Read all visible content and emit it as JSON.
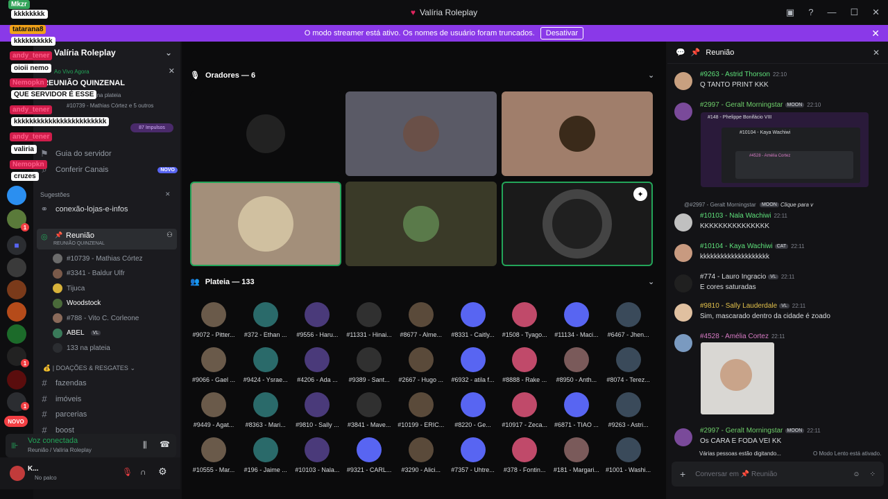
{
  "window": {
    "title": "Valíria Roleplay",
    "icons": [
      "inbox-icon",
      "help-icon",
      "minimize-icon",
      "maximize-icon",
      "close-icon"
    ]
  },
  "banner": {
    "text": "O modo streamer está ativo. Os nomes de usuário foram truncados.",
    "button": "Desativar"
  },
  "server": {
    "name": "Valíria Roleplay"
  },
  "live": {
    "label": "Ao Vivo Agora",
    "event": "REUNIÃO QUINZENAL",
    "audience": "133 na plateia",
    "speakers": "#10739 - Mathias Córtez e 5 outros"
  },
  "boost": {
    "label": "87 Impulsos"
  },
  "channels_top": [
    {
      "label": "Guia do servidor"
    },
    {
      "label": "Conferir Canais",
      "badge": "NOVO"
    }
  ],
  "suggestions": {
    "label": "Sugestões",
    "item": "conexão-lojas-e-infos"
  },
  "voice_channel": {
    "name": "Reunião",
    "sub": "REUNIÃO QUINZENAL"
  },
  "voice_users": [
    {
      "name": "#10739 - Mathias Córtez"
    },
    {
      "name": "#3341 - Baldur Ulfr"
    },
    {
      "name": "Tijuca"
    },
    {
      "name": "Woodstock"
    },
    {
      "name": "#788 - Vito C. Corleone"
    },
    {
      "name": "ABEL",
      "tag": "VL"
    },
    {
      "name": "133 na plateia"
    }
  ],
  "category": {
    "label": "| DOAÇÕES & RESGATES"
  },
  "channels_bottom": [
    {
      "label": "fazendas"
    },
    {
      "label": "imóveis"
    },
    {
      "label": "parcerias"
    },
    {
      "label": "boost"
    }
  ],
  "voicebar": {
    "status": "Voz conectada",
    "location": "Reunião / Valíria Roleplay"
  },
  "userbar": {
    "name": "K...",
    "status": "No palco"
  },
  "guild_badges": {
    "new_label": "NOVO"
  },
  "overlay": [
    {
      "text": "Mkzr",
      "style": "g"
    },
    {
      "text": "kkkkkkkk",
      "style": "w"
    },
    {
      "text": "tatarana8",
      "style": "o"
    },
    {
      "text": "kkkkkkkkkk",
      "style": "w"
    },
    {
      "text": "andy_tener",
      "style": "p"
    },
    {
      "text": "oioii nemo",
      "style": "w"
    },
    {
      "text": "Nemopkn",
      "style": "p"
    },
    {
      "text": "QUE SERVIDOR É ESSE",
      "style": "w"
    },
    {
      "text": "andy_tener",
      "style": "p"
    },
    {
      "text": "kkkkkkkkkkkkkkkkkkkkkkkk",
      "style": "w"
    },
    {
      "text": "andy_tener",
      "style": "p"
    },
    {
      "text": "valiria",
      "style": "w"
    },
    {
      "text": "Nemopkn",
      "style": "p"
    },
    {
      "text": "cruzes",
      "style": "w"
    }
  ],
  "stage": {
    "speakers_label": "Oradores — 6",
    "audience_label": "Plateia — 133",
    "tiles": [
      {
        "bg": "#0b0b0c"
      },
      {
        "bg": "#5a5a66"
      },
      {
        "bg": "#a07e6b"
      },
      {
        "bg": "#a38f7a"
      },
      {
        "bg": "#3a3a28"
      },
      {
        "bg": "#1a1a1a"
      }
    ],
    "audience": [
      "#9072 - Pitter...",
      "#372 - Ethan ...",
      "#9556 - Haru...",
      "#11331 - Hinai...",
      "#8677 - Alme...",
      "#8331 - Caitly...",
      "#1508 - Tyago...",
      "#11134 - Maci...",
      "#6467 - Jhen...",
      "#9066 - Gael ...",
      "#9424 - Ysrae...",
      "#4206 - Ada ...",
      "#9389 - Sant...",
      "#2667 - Hugo ...",
      "#6932 - atila f...",
      "#8888 - Rake ...",
      "#8950 - Anth...",
      "#8074 - Terez...",
      "#9449 - Agat...",
      "#8363 - Mari...",
      "#9810 - Sally ...",
      "#3841 - Mave...",
      "#10199 - ERIC...",
      "#8220 - Ge...",
      "#10917 - Zeca...",
      "#6871 - TIAO ...",
      "#9263 - Astri...",
      "#10555 - Mar...",
      "#196 - Jaime ...",
      "#10103 - Nala...",
      "#9321 - CARL...",
      "#3290 - Alici...",
      "#7357 - Uhtre...",
      "#378 - Fontin...",
      "#181 - Margari...",
      "#1001 - Washi..."
    ]
  },
  "chat": {
    "title": "Reunião",
    "messages": [
      {
        "name": "#9263 - Astrid Thorson",
        "time": "22:10",
        "text": "Q TANTO PRINT KKK",
        "color": "#5ee07a"
      },
      {
        "name": "#2997 - Geralt Morningstar",
        "tag": "MOON",
        "time": "22:10",
        "text": "",
        "color": "#6fcf6b"
      },
      {
        "name": "#10103 - Nala Wachiwi",
        "time": "22:11",
        "text": "KKKKKKKKKKKKKKK",
        "color": "#5ee07a"
      },
      {
        "name": "#10104 - Kaya Wachiwi",
        "tag": "CAT",
        "time": "22:11",
        "text": "kkkkkkkkkkkkkkkkkkkk",
        "color": "#5ee07a"
      },
      {
        "name": "#774 - Lauro",
        "extra": "Ingracio",
        "tag": "VL",
        "time": "22:11",
        "text": "E cores saturadas",
        "color": "#dbdee1"
      },
      {
        "name": "#9810 - Sally Lauderdale",
        "tag": "VL",
        "time": "22:11",
        "text": "Sim, mascarado dentro da cidade é zoado",
        "color": "#e3c14b"
      },
      {
        "name": "#4528 - Amélia Cortez",
        "time": "22:11",
        "text": "",
        "color": "#d87bc5"
      },
      {
        "name": "#2997 - Geralt Morningstar",
        "tag": "MOON",
        "time": "22:11",
        "text": "Os CARA E FODA VEI KK",
        "color": "#6fcf6b"
      }
    ],
    "reply_line": "@#2997 - Geralt Morningstar",
    "reply_tag": "MOON",
    "reply_text": "Clique para v",
    "embed_lines": [
      "#148 - Phelippe Bonifácio VIII",
      "#10104 - Kaya Wachiwi",
      "#4528 - Amélia Cortez"
    ],
    "typing": "Várias pessoas estão digitando...",
    "slowmode": "O Modo Lento está ativado.",
    "input_placeholder": "Conversar em 📌 Reunião"
  },
  "colors": {
    "accent": "#8a39e8",
    "brand": "#5865f2",
    "green": "#23a559",
    "red": "#f23f43"
  }
}
